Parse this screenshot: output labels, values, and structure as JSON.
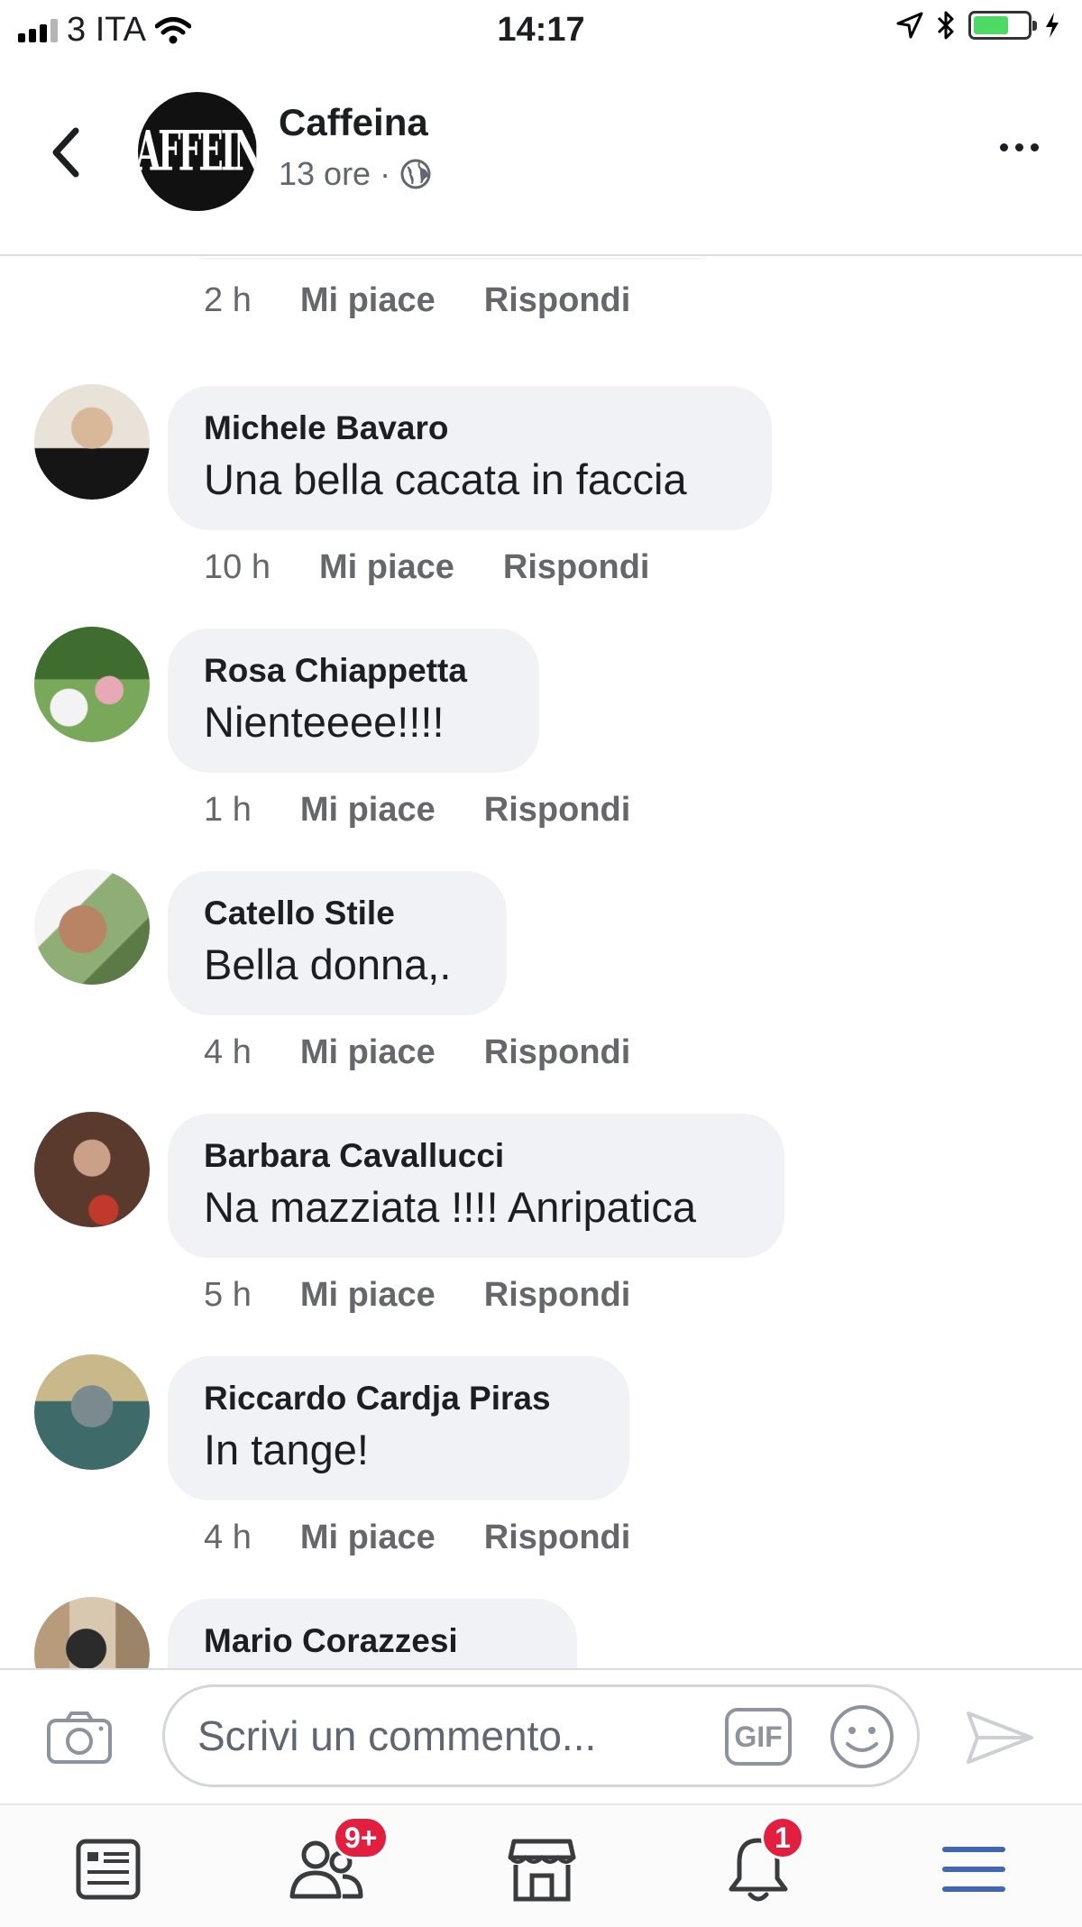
{
  "status_bar": {
    "carrier": "3 ITA",
    "time": "14:17"
  },
  "header": {
    "page_name": "Caffeina",
    "logo_text": "CAFFEINA",
    "post_age": "13 ore",
    "meta_separator": "·"
  },
  "comments": {
    "partial_top": {
      "time": "2 h",
      "like_label": "Mi piace",
      "reply_label": "Rispondi"
    },
    "items": [
      {
        "author": "Michele Bavaro",
        "text": "Una bella cacata in faccia",
        "time": "10 h",
        "like_label": "Mi piace",
        "reply_label": "Rispondi"
      },
      {
        "author": "Rosa Chiappetta",
        "text": "Nienteeee!!!!",
        "time": "1 h",
        "like_label": "Mi piace",
        "reply_label": "Rispondi"
      },
      {
        "author": "Catello Stile",
        "text": "Bella donna,.",
        "time": "4 h",
        "like_label": "Mi piace",
        "reply_label": "Rispondi"
      },
      {
        "author": "Barbara Cavallucci",
        "text": "Na mazziata !!!! Anripatica",
        "time": "5 h",
        "like_label": "Mi piace",
        "reply_label": "Rispondi"
      },
      {
        "author": "Riccardo Cardja Piras",
        "text": "In tange!",
        "time": "4 h",
        "like_label": "Mi piace",
        "reply_label": "Rispondi"
      },
      {
        "author": "Mario Corazzesi"
      }
    ]
  },
  "composer": {
    "placeholder": "Scrivi un commento...",
    "gif_label": "GIF"
  },
  "tabbar": {
    "friends_badge": "9+",
    "notifications_badge": "1",
    "active_color": "#4267b2"
  },
  "colors": {
    "bubble": "#f0f2f5",
    "badge": "#e41e3f",
    "battery": "#4cd964"
  }
}
